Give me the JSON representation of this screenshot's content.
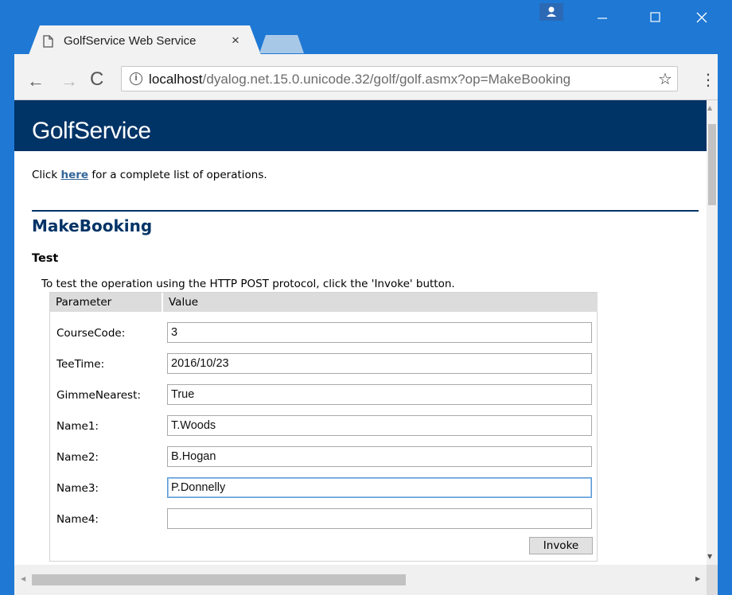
{
  "tab": {
    "title": "GolfService Web Service",
    "close": "×"
  },
  "window_controls": {
    "profile": "▲",
    "minimize": "—",
    "maximize": "☐",
    "close": "✕"
  },
  "toolbar": {
    "back": "←",
    "forward": "→",
    "reload": "C",
    "url_host": "localhost",
    "url_path": "/dyalog.net.15.0.unicode.32/golf/golf.asmx?op=MakeBooking",
    "info": "i",
    "star": "☆",
    "menu": "⋮"
  },
  "page": {
    "header_title": "GolfService",
    "intro_prefix": "Click ",
    "intro_link": "here",
    "intro_suffix": " for a complete list of operations.",
    "operation_title": "MakeBooking",
    "test_heading": "Test",
    "test_description": "To test the operation using the HTTP POST protocol, click the 'Invoke' button.",
    "table": {
      "headers": [
        "Parameter",
        "Value"
      ],
      "rows": [
        {
          "label": "CourseCode:",
          "value": "3"
        },
        {
          "label": "TeeTime:",
          "value": "2016/10/23"
        },
        {
          "label": "GimmeNearest:",
          "value": "True"
        },
        {
          "label": "Name1:",
          "value": "T.Woods"
        },
        {
          "label": "Name2:",
          "value": "B.Hogan"
        },
        {
          "label": "Name3:",
          "value": "P.Donnelly"
        },
        {
          "label": "Name4:",
          "value": ""
        }
      ]
    },
    "invoke_label": "Invoke"
  },
  "scrollbars": {
    "up": "▲",
    "down": "▼",
    "left": "◀",
    "right": "▶"
  },
  "colors": {
    "header_bg": "#003366",
    "chrome_blue": "#1e78d4",
    "link": "#336699"
  }
}
